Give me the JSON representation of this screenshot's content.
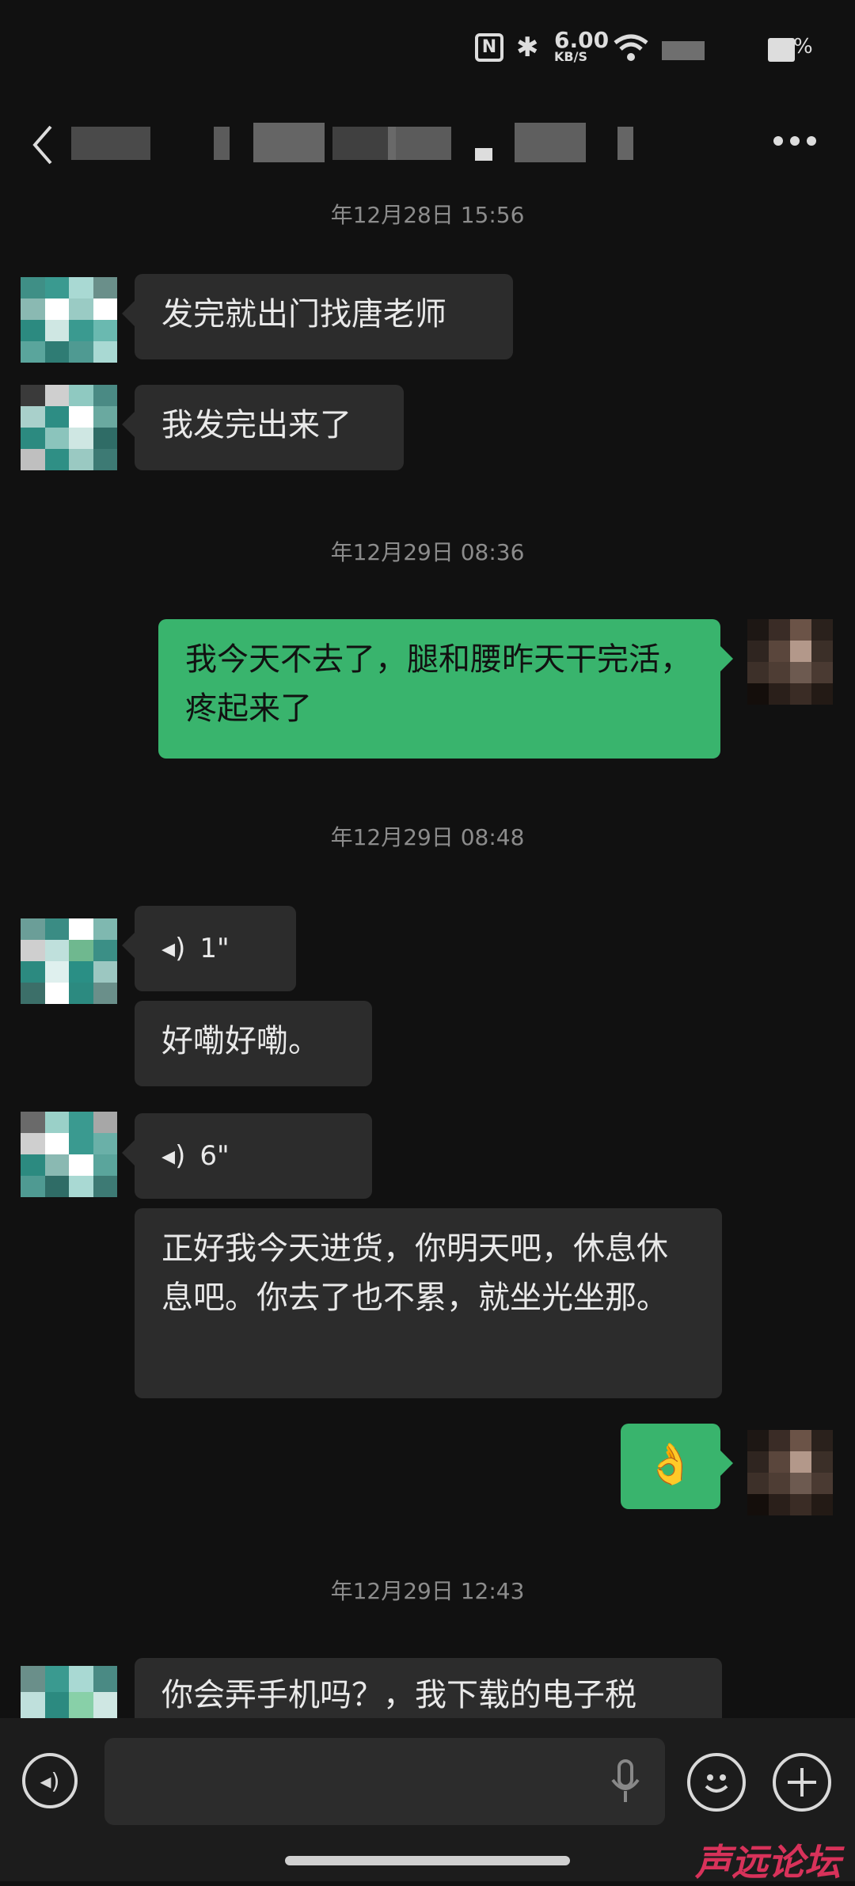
{
  "status_bar": {
    "nfc": "N",
    "speed_value": "6.00",
    "speed_unit": "KB/S",
    "battery_text": "%"
  },
  "header": {
    "back_label": "<",
    "more_label": "⋯"
  },
  "messages": {
    "ts1": "年12月28日 15:56",
    "m1": "发完就出门找唐老师",
    "m2": "我发完出来了",
    "ts2": "年12月29日 08:36",
    "m3": "我今天不去了，腿和腰昨天干完活，疼起来了",
    "ts3": "年12月29日 08:48",
    "v1": "1\"",
    "m4": "好嘞好嘞。",
    "v2": "6\"",
    "m5": "正好我今天进货，你明天吧，休息休息吧。你去了也不累，就坐光坐那。",
    "m6": "👌",
    "ts4": "年12月29日 12:43",
    "m7": "你会弄手机吗？，我下载的电子税"
  },
  "watermark": "声远论坛",
  "colors": {
    "bg": "#111111",
    "left_bubble": "#2c2c2c",
    "right_bubble": "#39b46d"
  }
}
